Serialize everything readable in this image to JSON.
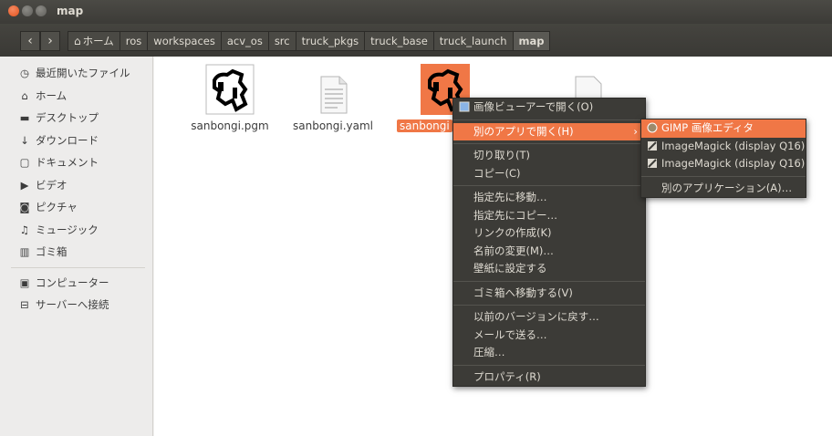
{
  "window": {
    "title": "map"
  },
  "nav": {
    "back": "‹",
    "forward": "›"
  },
  "breadcrumbs": [
    {
      "label": "ホーム"
    },
    {
      "label": "ros"
    },
    {
      "label": "workspaces"
    },
    {
      "label": "acv_os"
    },
    {
      "label": "src"
    },
    {
      "label": "truck_pkgs"
    },
    {
      "label": "truck_base"
    },
    {
      "label": "truck_launch"
    },
    {
      "label": "map"
    }
  ],
  "sidebar": {
    "items": [
      {
        "label": "最近開いたファイル",
        "icon": "clock-icon"
      },
      {
        "label": "ホーム",
        "icon": "home-icon"
      },
      {
        "label": "デスクトップ",
        "icon": "folder-icon"
      },
      {
        "label": "ダウンロード",
        "icon": "download-icon"
      },
      {
        "label": "ドキュメント",
        "icon": "document-icon"
      },
      {
        "label": "ビデオ",
        "icon": "video-icon"
      },
      {
        "label": "ピクチャ",
        "icon": "camera-icon"
      },
      {
        "label": "ミュージック",
        "icon": "music-icon"
      },
      {
        "label": "ゴミ箱",
        "icon": "trash-icon"
      },
      {
        "label": "コンピューター",
        "icon": "computer-icon"
      },
      {
        "label": "サーバーへ接続",
        "icon": "server-icon"
      }
    ]
  },
  "files": [
    {
      "name": "sanbongi.pgm",
      "type": "image"
    },
    {
      "name": "sanbongi.yaml",
      "type": "text"
    },
    {
      "name": "sanbongi",
      "type": "image",
      "selected": true
    },
    {
      "name": "",
      "type": "text"
    }
  ],
  "context_menu": {
    "items": [
      "画像ビューアーで開く(O)",
      "別のアプリで開く(H)",
      "切り取り(T)",
      "コピー(C)",
      "指定先に移動…",
      "指定先にコピー…",
      "リンクの作成(K)",
      "名前の変更(M)…",
      "壁紙に設定する",
      "ゴミ箱へ移動する(V)",
      "以前のバージョンに戻す…",
      "メールで送る…",
      "圧縮…",
      "プロパティ(R)"
    ],
    "submenu_arrow": "›"
  },
  "submenu": {
    "items": [
      "GIMP 画像エディタ",
      "ImageMagick (display Q16)",
      "ImageMagick (display Q16)",
      "別のアプリケーション(A)…"
    ]
  },
  "colors": {
    "accent": "#f07746",
    "menu_bg": "#3c3b37",
    "titlebar": "#3c3b37"
  }
}
